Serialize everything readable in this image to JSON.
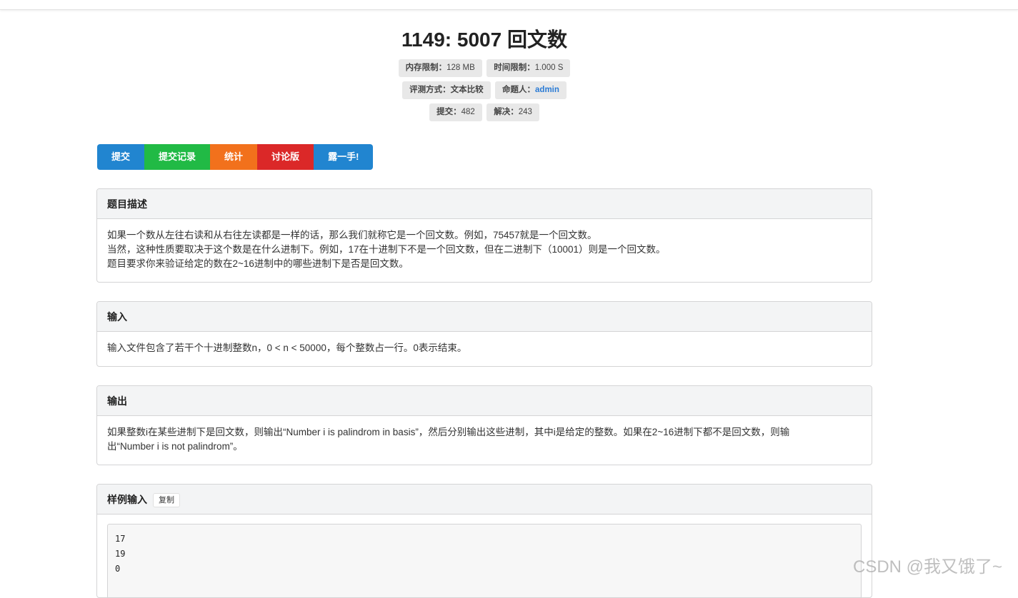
{
  "problem": {
    "title": "1149: 5007 回文数",
    "memory_label": "内存限制：",
    "memory_value": "128 MB",
    "time_label": "时间限制：",
    "time_value": "1.000 S",
    "judge_label": "评测方式：",
    "judge_value": "文本比较",
    "author_label": "命题人：",
    "author_value": "admin",
    "submit_label": "提交：",
    "submit_value": "482",
    "solved_label": "解决：",
    "solved_value": "243"
  },
  "actions": {
    "submit": "提交",
    "records": "提交记录",
    "stats": "统计",
    "discuss": "讨论版",
    "show_off": "露一手!"
  },
  "sections": {
    "description": {
      "heading": "题目描述",
      "lines": [
        "如果一个数从左往右读和从右往左读都是一样的话，那么我们就称它是一个回文数。例如，75457就是一个回文数。",
        "当然，这种性质要取决于这个数是在什么进制下。例如，17在十进制下不是一个回文数，但在二进制下（10001）则是一个回文数。",
        "题目要求你来验证给定的数在2~16进制中的哪些进制下是否是回文数。"
      ]
    },
    "input": {
      "heading": "输入",
      "text": "输入文件包含了若干个十进制整数n，0 < n < 50000，每个整数占一行。0表示结束。"
    },
    "output": {
      "heading": "输出",
      "lines": [
        "如果整数i在某些进制下是回文数，则输出“Number i is palindrom in basis”，然后分别输出这些进制，其中i是给定的整数。如果在2~16进制下都不是回文数，则输",
        "出“Number i is not palindrom”。"
      ]
    },
    "sample_input": {
      "heading": "样例输入",
      "copy_label": "复制",
      "code_lines": [
        "17",
        "19",
        "0"
      ]
    }
  },
  "watermark": "CSDN @我又饿了~",
  "colors": {
    "blue": "#2185d0",
    "green": "#21ba45",
    "orange": "#f2711c",
    "red": "#db2828"
  }
}
